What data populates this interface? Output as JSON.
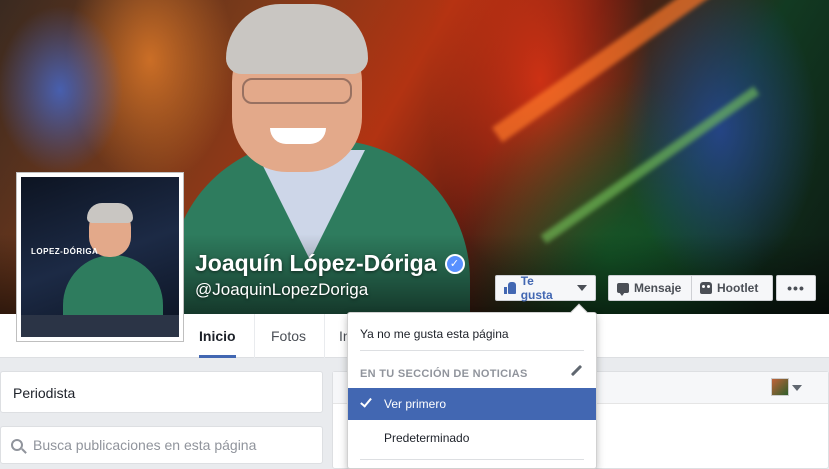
{
  "page": {
    "name": "Joaquín López-Dóriga",
    "handle": "@JoaquinLopezDoriga",
    "verified": true,
    "profile_pic_brand": "LOPEZ-DÓRIGA"
  },
  "actions": {
    "like_label": "Te gusta",
    "message_label": "Mensaje",
    "hootlet_label": "Hootlet",
    "more_label": "•••"
  },
  "tabs": [
    {
      "label": "Inicio",
      "active": true
    },
    {
      "label": "Fotos",
      "active": false
    },
    {
      "label": "In",
      "active": false
    }
  ],
  "sidebar": {
    "category": "Periodista",
    "search_placeholder": "Busca publicaciones en esta página"
  },
  "dropdown": {
    "unlike_label": "Ya no me gusta esta página",
    "section_title": "EN TU SECCIÓN DE NOTICIAS",
    "options": [
      {
        "label": "Ver primero",
        "selected": true
      },
      {
        "label": "Predeterminado",
        "selected": false
      }
    ]
  },
  "colors": {
    "brand_blue": "#4267b2",
    "verified_blue": "#5890ff",
    "background": "#e9ebee"
  }
}
